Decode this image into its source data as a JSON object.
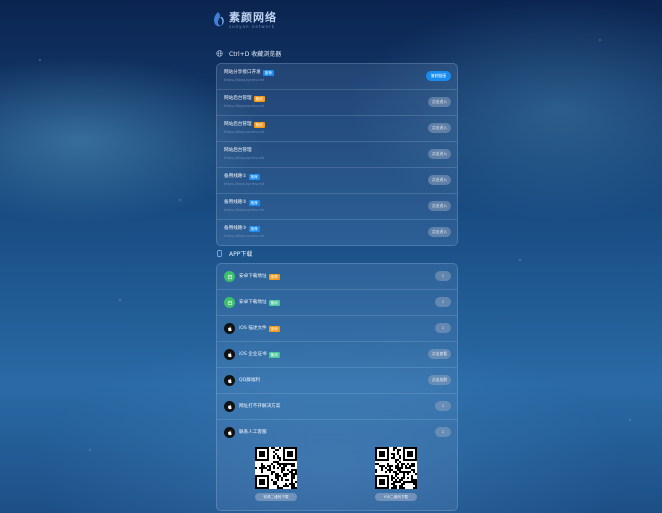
{
  "logo": {
    "title": "素颜网络",
    "subtitle": "sunyan network"
  },
  "colors": {
    "blue": "#1a8cf0",
    "orange": "#f39a1b",
    "green": "#3bbf6b",
    "teal": "#4cc79a",
    "appleBlack": "#111111"
  },
  "browser": {
    "title": "Ctrl+D 收藏浏览器",
    "rows": [
      {
        "title": "网站分享接口开发",
        "tag": "推荐",
        "tagColor": "#1a8cf0",
        "url": "https://blog.sycms.net",
        "button": "复制链接",
        "primary": true
      },
      {
        "title": "网站后台管理",
        "tag": "备用",
        "tagColor": "#f39a1b",
        "url": "https://blog.sycms.net",
        "button": "点击进入",
        "primary": false
      },
      {
        "title": "网站后台管理",
        "tag": "备用",
        "tagColor": "#f39a1b",
        "url": "https://blog.sycms.net",
        "button": "点击进入",
        "primary": false
      },
      {
        "title": "网站后台管理",
        "tag": "",
        "tagColor": "",
        "url": "https://blog.sycms.net",
        "button": "点击进入",
        "primary": false
      },
      {
        "title": "备用线路①",
        "tag": "推荐",
        "tagColor": "#1a8cf0",
        "url": "https://blog.sycms.net",
        "button": "点击进入",
        "primary": false
      },
      {
        "title": "备用线路②",
        "tag": "推荐",
        "tagColor": "#1a8cf0",
        "url": "https://blog.sycms.net",
        "button": "点击进入",
        "primary": false
      },
      {
        "title": "备用线路③",
        "tag": "推荐",
        "tagColor": "#1a8cf0",
        "url": "https://blog.sycms.net",
        "button": "点击进入",
        "primary": false
      }
    ]
  },
  "app": {
    "title": "APP下载",
    "rows": [
      {
        "icon": "android-icon",
        "iconColor": "#3bbf6b",
        "title": "安卓下载地址",
        "tag": "推荐",
        "tagColor": "#f39a1b",
        "button": "⇩"
      },
      {
        "icon": "android-icon",
        "iconColor": "#3bbf6b",
        "title": "安卓下载地址",
        "tag": "备用",
        "tagColor": "#4cc79a",
        "button": "⇩"
      },
      {
        "icon": "apple-icon",
        "iconColor": "#111111",
        "title": "iOS 描述文件",
        "tag": "推荐",
        "tagColor": "#f39a1b",
        "button": "⇩"
      },
      {
        "icon": "apple-icon",
        "iconColor": "#111111",
        "title": "iOS 企业证书",
        "tag": "备用",
        "tagColor": "#4cc79a",
        "button": "点击查看"
      },
      {
        "icon": "apple-icon",
        "iconColor": "#111111",
        "title": "QQ群福利",
        "tag": "",
        "tagColor": "",
        "button": "点击加群"
      },
      {
        "icon": "apple-icon",
        "iconColor": "#111111",
        "title": "网址打不开解决方案",
        "tag": "",
        "tagColor": "",
        "button": "⇩"
      },
      {
        "icon": "apple-icon",
        "iconColor": "#111111",
        "title": "联系人工客服",
        "tag": "",
        "tagColor": "",
        "button": "⇩"
      }
    ],
    "qr": [
      {
        "label": "安卓二维码下载"
      },
      {
        "label": "iOS二维码下载"
      }
    ]
  }
}
